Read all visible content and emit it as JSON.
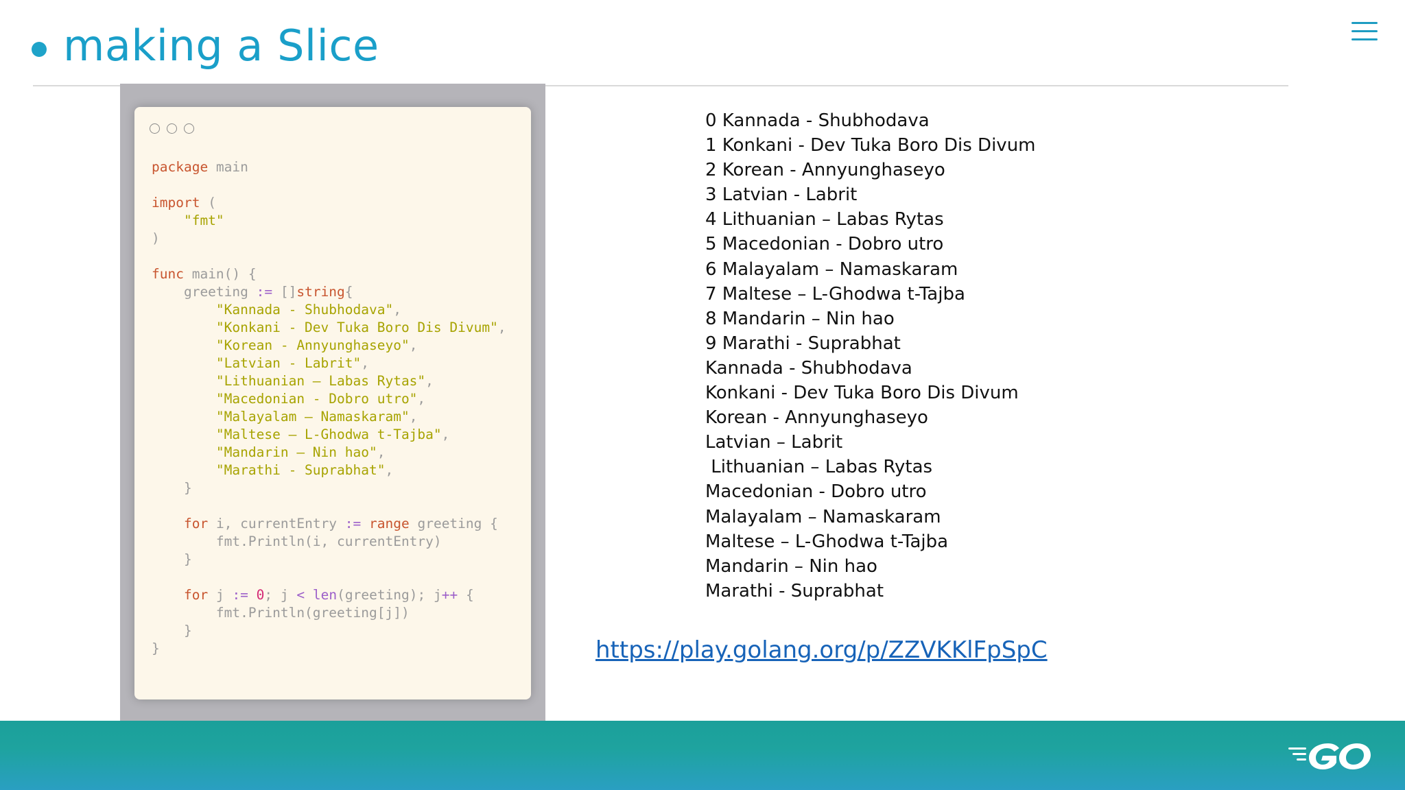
{
  "slide": {
    "title": "making a Slice",
    "link": "https://play.golang.org/p/ZZVKKlFpSpC"
  },
  "code": {
    "lines": [
      [
        {
          "t": "package",
          "c": "kw"
        },
        {
          "t": " main",
          "c": "pun"
        }
      ],
      [],
      [
        {
          "t": "import",
          "c": "kw"
        },
        {
          "t": " (",
          "c": "pun"
        }
      ],
      [
        {
          "t": "    ",
          "c": "pun"
        },
        {
          "t": "\"fmt\"",
          "c": "str"
        }
      ],
      [
        {
          "t": ")",
          "c": "pun"
        }
      ],
      [],
      [
        {
          "t": "func",
          "c": "kw"
        },
        {
          "t": " main() {",
          "c": "pun"
        }
      ],
      [
        {
          "t": "    greeting ",
          "c": "pun"
        },
        {
          "t": ":=",
          "c": "op"
        },
        {
          "t": " []",
          "c": "pun"
        },
        {
          "t": "string",
          "c": "kw"
        },
        {
          "t": "{",
          "c": "pun"
        }
      ],
      [
        {
          "t": "        ",
          "c": "pun"
        },
        {
          "t": "\"Kannada - Shubhodava\"",
          "c": "str"
        },
        {
          "t": ",",
          "c": "pun"
        }
      ],
      [
        {
          "t": "        ",
          "c": "pun"
        },
        {
          "t": "\"Konkani - Dev Tuka Boro Dis Divum\"",
          "c": "str"
        },
        {
          "t": ",",
          "c": "pun"
        }
      ],
      [
        {
          "t": "        ",
          "c": "pun"
        },
        {
          "t": "\"Korean - Annyunghaseyo\"",
          "c": "str"
        },
        {
          "t": ",",
          "c": "pun"
        }
      ],
      [
        {
          "t": "        ",
          "c": "pun"
        },
        {
          "t": "\"Latvian - Labrit\"",
          "c": "str"
        },
        {
          "t": ",",
          "c": "pun"
        }
      ],
      [
        {
          "t": "        ",
          "c": "pun"
        },
        {
          "t": "\"Lithuanian – Labas Rytas\"",
          "c": "str"
        },
        {
          "t": ",",
          "c": "pun"
        }
      ],
      [
        {
          "t": "        ",
          "c": "pun"
        },
        {
          "t": "\"Macedonian - Dobro utro\"",
          "c": "str"
        },
        {
          "t": ",",
          "c": "pun"
        }
      ],
      [
        {
          "t": "        ",
          "c": "pun"
        },
        {
          "t": "\"Malayalam – Namaskaram\"",
          "c": "str"
        },
        {
          "t": ",",
          "c": "pun"
        }
      ],
      [
        {
          "t": "        ",
          "c": "pun"
        },
        {
          "t": "\"Maltese – L-Ghodwa t-Tajba\"",
          "c": "str"
        },
        {
          "t": ",",
          "c": "pun"
        }
      ],
      [
        {
          "t": "        ",
          "c": "pun"
        },
        {
          "t": "\"Mandarin – Nin hao\"",
          "c": "str"
        },
        {
          "t": ",",
          "c": "pun"
        }
      ],
      [
        {
          "t": "        ",
          "c": "pun"
        },
        {
          "t": "\"Marathi - Suprabhat\"",
          "c": "str"
        },
        {
          "t": ",",
          "c": "pun"
        }
      ],
      [
        {
          "t": "    }",
          "c": "pun"
        }
      ],
      [],
      [
        {
          "t": "    ",
          "c": "pun"
        },
        {
          "t": "for",
          "c": "kw"
        },
        {
          "t": " i, currentEntry ",
          "c": "pun"
        },
        {
          "t": ":=",
          "c": "op"
        },
        {
          "t": " ",
          "c": "pun"
        },
        {
          "t": "range",
          "c": "kw"
        },
        {
          "t": " greeting {",
          "c": "pun"
        }
      ],
      [
        {
          "t": "        fmt.Println(i, currentEntry)",
          "c": "pun"
        }
      ],
      [
        {
          "t": "    }",
          "c": "pun"
        }
      ],
      [],
      [
        {
          "t": "    ",
          "c": "pun"
        },
        {
          "t": "for",
          "c": "kw"
        },
        {
          "t": " j ",
          "c": "pun"
        },
        {
          "t": ":=",
          "c": "op"
        },
        {
          "t": " ",
          "c": "pun"
        },
        {
          "t": "0",
          "c": "num"
        },
        {
          "t": "; j ",
          "c": "pun"
        },
        {
          "t": "<",
          "c": "op"
        },
        {
          "t": " ",
          "c": "pun"
        },
        {
          "t": "len",
          "c": "op"
        },
        {
          "t": "(greeting); j",
          "c": "pun"
        },
        {
          "t": "++",
          "c": "op"
        },
        {
          "t": " {",
          "c": "pun"
        }
      ],
      [
        {
          "t": "        fmt.Println(greeting[j])",
          "c": "pun"
        }
      ],
      [
        {
          "t": "    }",
          "c": "pun"
        }
      ],
      [
        {
          "t": "}",
          "c": "pun"
        }
      ]
    ]
  },
  "output": [
    "0 Kannada - Shubhodava",
    "1 Konkani - Dev Tuka Boro Dis Divum",
    "2 Korean - Annyunghaseyo",
    "3 Latvian - Labrit",
    "4 Lithuanian – Labas Rytas",
    "5 Macedonian - Dobro utro",
    "6 Malayalam – Namaskaram",
    "7 Maltese – L-Ghodwa t-Tajba",
    "8 Mandarin – Nin hao",
    "9 Marathi - Suprabhat",
    "Kannada - Shubhodava",
    "Konkani - Dev Tuka Boro Dis Divum",
    "Korean - Annyunghaseyo",
    "Latvian – Labrit",
    " Lithuanian – Labas Rytas",
    "Macedonian - Dobro utro",
    "Malayalam – Namaskaram",
    "Maltese – L-Ghodwa t-Tajba",
    "Mandarin – Nin hao",
    "Marathi - Suprabhat"
  ],
  "icons": {
    "menu": "hamburger-menu-icon",
    "logo": "go-logo"
  },
  "colors": {
    "title": "#1a9fc9",
    "link": "#1763b8",
    "footer_top": "#1ba09a",
    "footer_bottom": "#2a9fc2"
  }
}
